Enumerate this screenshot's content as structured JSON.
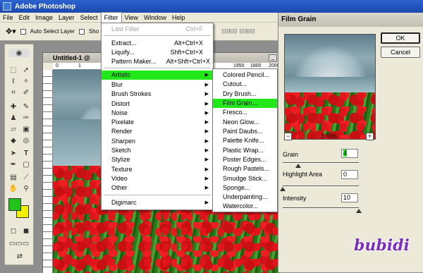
{
  "window": {
    "title": "Adobe Photoshop"
  },
  "menubar": [
    "File",
    "Edit",
    "Image",
    "Layer",
    "Select",
    "Filter",
    "View",
    "Window",
    "Help"
  ],
  "options": {
    "auto_select": "Auto Select Layer",
    "show": "Sho"
  },
  "document": {
    "title": "Untitled-1 @",
    "ruler_marks": [
      "0",
      "1",
      "1950",
      "1800",
      "2000"
    ]
  },
  "filter_menu": {
    "last_filter": {
      "label": "Last Filter",
      "shortcut": "Ctrl+F"
    },
    "extract": {
      "label": "Extract...",
      "shortcut": "Alt+Ctrl+X"
    },
    "liquify": {
      "label": "Liquify...",
      "shortcut": "Shft+Ctrl+X"
    },
    "pattern": {
      "label": "Pattern Maker...",
      "shortcut": "Alt+Shft+Ctrl+X"
    },
    "categories": [
      "Artistic",
      "Blur",
      "Brush Strokes",
      "Distort",
      "Noise",
      "Pixelate",
      "Render",
      "Sharpen",
      "Sketch",
      "Stylize",
      "Texture",
      "Video",
      "Other"
    ],
    "digimarc": "Digimarc"
  },
  "artistic_submenu": [
    "Colored Pencil...",
    "Cutout...",
    "Dry Brush...",
    "Film Grain...",
    "Fresco...",
    "Neon Glow...",
    "Paint Daubs...",
    "Palette Knife...",
    "Plastic Wrap...",
    "Poster Edges...",
    "Rough Pastels...",
    "Smudge Stick...",
    "Sponge...",
    "Underpainting...",
    "Watercolor..."
  ],
  "dialog": {
    "title": "Film Grain",
    "ok": "OK",
    "cancel": "Cancel",
    "zoom": "100%",
    "zoom_minus": "−",
    "zoom_plus": "+",
    "grain": {
      "label": "Grain",
      "value": "4",
      "fraction": 0.2
    },
    "highlight": {
      "label": "Highlight Area",
      "value": "0",
      "fraction": 0.0
    },
    "intensity": {
      "label": "Intensity",
      "value": "10",
      "fraction": 1.0
    }
  },
  "colors": {
    "foreground": "#22c41a",
    "background": "#f0f000",
    "highlight": "#22e81a"
  },
  "watermark": "bubidi"
}
